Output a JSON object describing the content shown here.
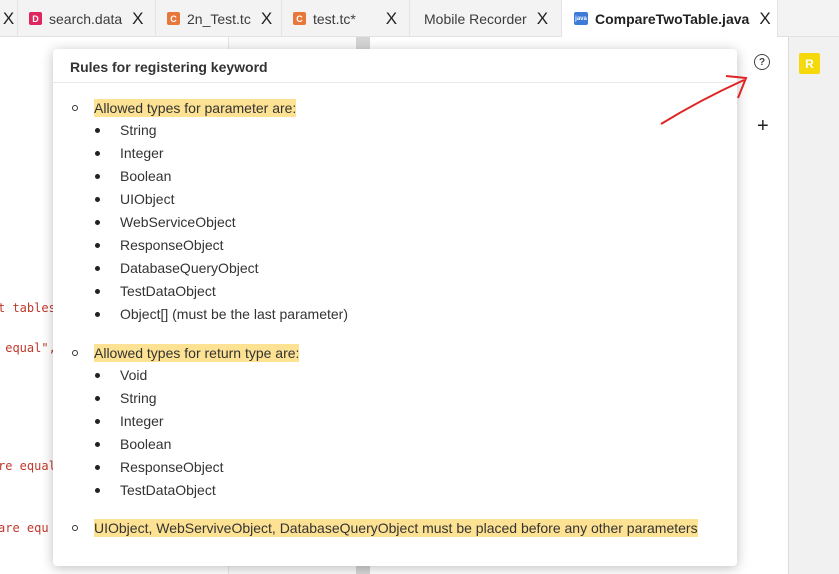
{
  "tabs": [
    {
      "label": "",
      "icon": "",
      "icon_color": ""
    },
    {
      "label": "search.data",
      "icon": "D",
      "icon_color": "#e0245e"
    },
    {
      "label": "2n_Test.tc",
      "icon": "C",
      "icon_color": "#e8773a"
    },
    {
      "label": "test.tc*",
      "icon": "C",
      "icon_color": "#e8773a"
    },
    {
      "label": "Mobile Recorder",
      "icon": "",
      "icon_color": ""
    },
    {
      "label": "CompareTwoTable.java",
      "icon": "java",
      "icon_color": "#3d7bd6"
    }
  ],
  "tab_close_glyph": "X",
  "code_snippets": [
    "t tables",
    " equal\",",
    "re equal",
    "are equ"
  ],
  "sidebar": {
    "r_icon": "R"
  },
  "plus_label": "+",
  "help_label": "?",
  "popup": {
    "title": "Rules for registering keyword",
    "param_heading": "Allowed types for parameter are:",
    "param_types": [
      "String",
      "Integer",
      "Boolean",
      "UIObject",
      "WebServiceObject",
      "ResponseObject",
      "DatabaseQueryObject",
      "TestDataObject",
      "Object[] (must be the last parameter)"
    ],
    "return_heading": "Allowed types for return type are:",
    "return_types": [
      "Void",
      "String",
      "Integer",
      "Boolean",
      "ResponseObject",
      "TestDataObject"
    ],
    "ordering_rule": "UIObject, WebServiveObject, DatabaseQueryObject must be placed before any other parameters"
  },
  "colors": {
    "highlight": "#fde293",
    "annotation_arrow": "#e02424"
  }
}
